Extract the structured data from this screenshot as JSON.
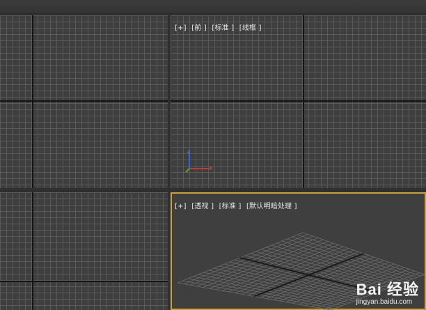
{
  "viewports": {
    "front": {
      "labels": [
        "[+]",
        "[前 ]",
        "[标准 ]",
        "[线框 ]"
      ]
    },
    "perspective": {
      "labels": [
        "[+]",
        "[透视 ]",
        "[标准 ]",
        "[默认明暗处理 ]"
      ]
    }
  },
  "gizmo": {
    "axes": [
      "Z",
      "X"
    ]
  },
  "watermark": {
    "brand": "Bai 经验",
    "url": "jingyan.baidu.com"
  },
  "colors": {
    "active_border": "#c9a13f",
    "grid_line": "#5a5a5a",
    "axis_line": "#141414",
    "viewport_bg": "#3e3e3e"
  }
}
